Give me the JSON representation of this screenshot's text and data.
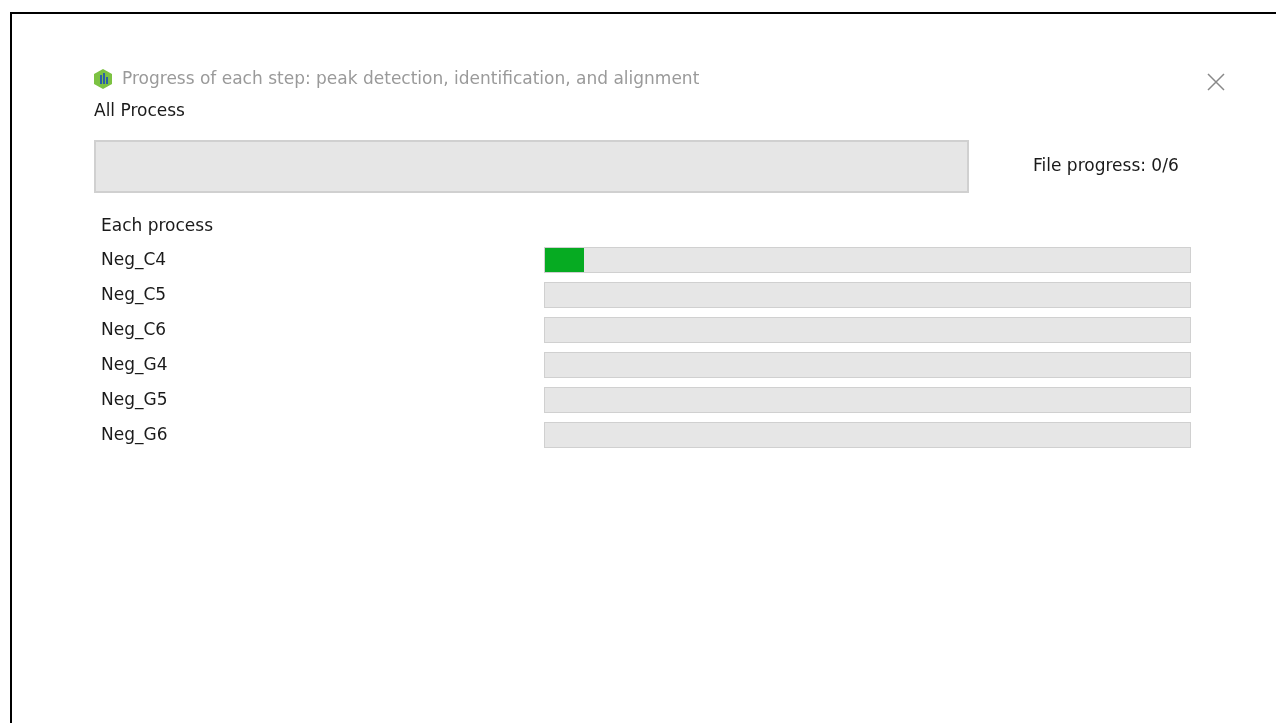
{
  "window": {
    "title": "Progress of each step: peak detection, identification, and alignment"
  },
  "all_process": {
    "label": "All Process",
    "level": 0,
    "file_progress": "File progress: 0/6"
  },
  "each_process": {
    "label": "Each process",
    "items": [
      {
        "name": "Neg_C4",
        "level": 0.06
      },
      {
        "name": "Neg_C5",
        "level": 0
      },
      {
        "name": "Neg_C6",
        "level": 0
      },
      {
        "name": "Neg_G4",
        "level": 0
      },
      {
        "name": "Neg_G5",
        "level": 0
      },
      {
        "name": "Neg_G6",
        "level": 0
      }
    ]
  }
}
